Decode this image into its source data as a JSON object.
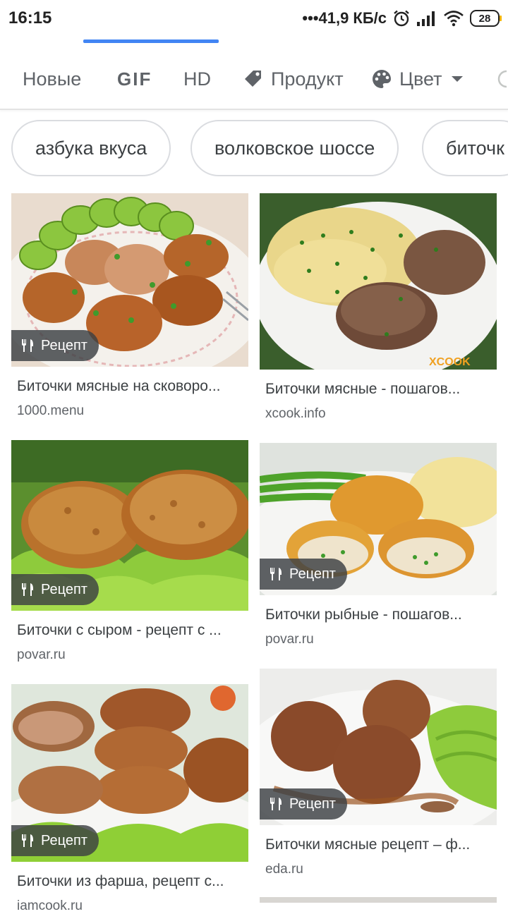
{
  "status_bar": {
    "time": "16:15",
    "network_speed": "•••41,9 КБ/с",
    "battery": "28",
    "icons": [
      "alarm-icon",
      "signal-icon",
      "wifi-icon",
      "battery-icon"
    ]
  },
  "filters": {
    "new_label": "Новые",
    "gif_label": "GIF",
    "hd_label": "HD",
    "product_label": "Продукт",
    "color_label": "Цвет",
    "accent_color": "#4285f4"
  },
  "chips": [
    "азбука вкуса",
    "волковское шоссе",
    "биточк"
  ],
  "badge_label": "Рецепт",
  "results": [
    {
      "title": "Биточки мясные на сковоро...",
      "source": "1000.menu"
    },
    {
      "title": "Биточки мясные - пошагов...",
      "source": "xcook.info",
      "watermark": "XCOOK"
    },
    {
      "title": "Биточки с сыром - рецепт с ...",
      "source": "povar.ru"
    },
    {
      "title": "Биточки рыбные - пошагов...",
      "source": "povar.ru"
    },
    {
      "title": "Биточки из фарша, рецепт с...",
      "source": "iamcook.ru"
    },
    {
      "title": "Биточки мясные рецепт – ф...",
      "source": "eda.ru"
    }
  ]
}
